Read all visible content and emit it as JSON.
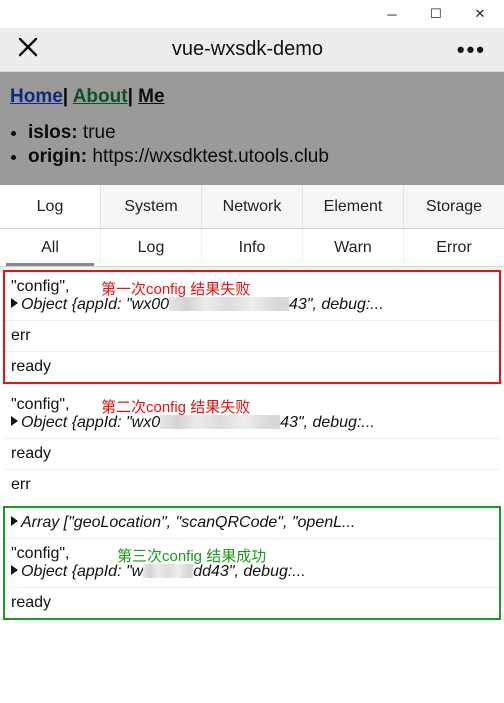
{
  "window": {
    "title": "vue-wxsdk-demo"
  },
  "nav": {
    "home": "Home",
    "about": "About",
    "me": "Me",
    "sep": "| "
  },
  "info": {
    "isIos_key": "isIos:",
    "isIos_val": " true",
    "origin_key": "origin:",
    "origin_val": " https://wxsdktest.utools.club"
  },
  "main_tabs": [
    "Log",
    "System",
    "Network",
    "Element",
    "Storage"
  ],
  "sub_tabs": [
    "All",
    "Log",
    "Info",
    "Warn",
    "Error"
  ],
  "annot": {
    "a1": "第一次config 结果失败",
    "a2": "第二次config 结果失败",
    "a3": "第三次config 结果成功"
  },
  "log": {
    "config": "\"config\",",
    "obj_pre": "Object {appId: \"wx0",
    "obj_pre2": "Object {appId: \"wx00",
    "obj_pre3": "Object {appId: \"w",
    "obj_suf43": "43\", debug:...",
    "obj_sufdd43": "dd43\", debug:...",
    "err": "err",
    "ready": "ready",
    "array": "Array [\"geoLocation\", \"scanQRCode\", \"openL..."
  }
}
